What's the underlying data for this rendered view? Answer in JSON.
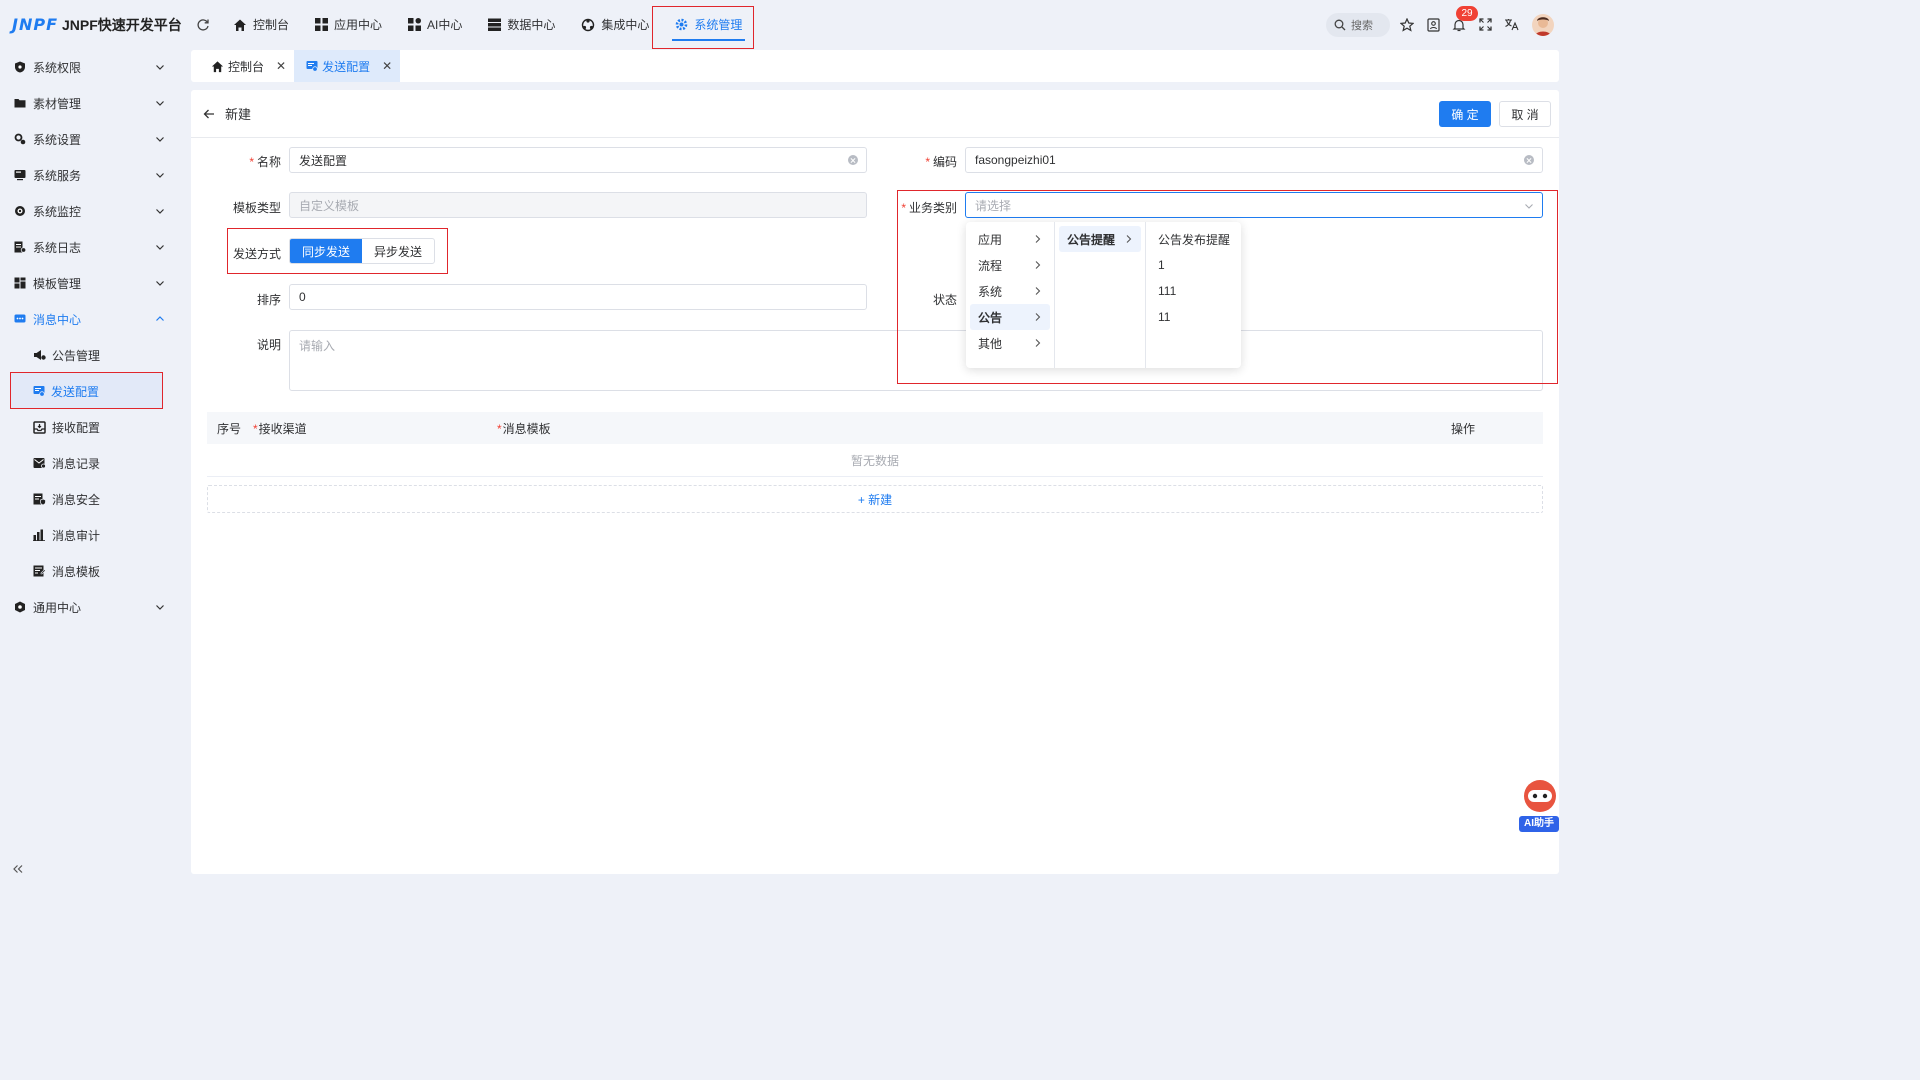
{
  "app": {
    "logo_mark": "JNPF",
    "title": "JNPF快速开发平台"
  },
  "topnav": [
    {
      "label": "控制台",
      "icon": "home-icon"
    },
    {
      "label": "应用中心",
      "icon": "grid-icon"
    },
    {
      "label": "AI中心",
      "icon": "apps-icon"
    },
    {
      "label": "数据中心",
      "icon": "database-icon"
    },
    {
      "label": "集成中心",
      "icon": "integration-icon"
    },
    {
      "label": "系统管理",
      "icon": "gear-icon",
      "active": true
    }
  ],
  "topbar": {
    "search_placeholder": "搜索",
    "notification_count": "29"
  },
  "sidebar": {
    "items": [
      {
        "label": "系统权限",
        "icon": "shield-icon"
      },
      {
        "label": "素材管理",
        "icon": "folder-icon"
      },
      {
        "label": "系统设置",
        "icon": "settings-icon"
      },
      {
        "label": "系统服务",
        "icon": "server-icon"
      },
      {
        "label": "系统监控",
        "icon": "monitor-icon"
      },
      {
        "label": "系统日志",
        "icon": "log-icon"
      },
      {
        "label": "模板管理",
        "icon": "template-icon"
      },
      {
        "label": "消息中心",
        "icon": "message-icon",
        "open": true
      },
      {
        "label": "通用中心",
        "icon": "common-icon"
      }
    ],
    "message_sub": [
      {
        "label": "公告管理",
        "icon": "announcement-icon"
      },
      {
        "label": "发送配置",
        "icon": "send-config-icon",
        "active": true
      },
      {
        "label": "接收配置",
        "icon": "receive-config-icon"
      },
      {
        "label": "消息记录",
        "icon": "record-icon"
      },
      {
        "label": "消息安全",
        "icon": "security-icon"
      },
      {
        "label": "消息审计",
        "icon": "audit-icon"
      },
      {
        "label": "消息模板",
        "icon": "msg-template-icon"
      }
    ]
  },
  "tabs": [
    {
      "label": "控制台"
    },
    {
      "label": "发送配置",
      "active": true
    }
  ],
  "page": {
    "title": "新建",
    "confirm": "确 定",
    "cancel": "取 消"
  },
  "form": {
    "name_label": "名称",
    "name_value": "发送配置",
    "code_label": "编码",
    "code_value": "fasongpeizhi01",
    "template_type_label": "模板类型",
    "template_type_value": "自定义模板",
    "category_label": "业务类别",
    "category_placeholder": "请选择",
    "send_mode_label": "发送方式",
    "send_mode_sync": "同步发送",
    "send_mode_async": "异步发送",
    "sort_label": "排序",
    "sort_value": "0",
    "status_label": "状态",
    "desc_label": "说明",
    "desc_placeholder": "请输入"
  },
  "table": {
    "col_index": "序号",
    "col_channel": "接收渠道",
    "col_template": "消息模板",
    "col_action": "操作",
    "empty": "暂无数据",
    "add": "+ 新建"
  },
  "cascader": {
    "col1": [
      "应用",
      "流程",
      "系统",
      "公告",
      "其他"
    ],
    "col1_selected": "公告",
    "col2": [
      "公告提醒"
    ],
    "col3": [
      "公告发布提醒",
      "1",
      "111",
      "11"
    ]
  },
  "ai_helper": "AI助手",
  "colors": {
    "primary": "#1f7cf0",
    "highlight_box": "#e0262c",
    "danger": "#f04134"
  }
}
